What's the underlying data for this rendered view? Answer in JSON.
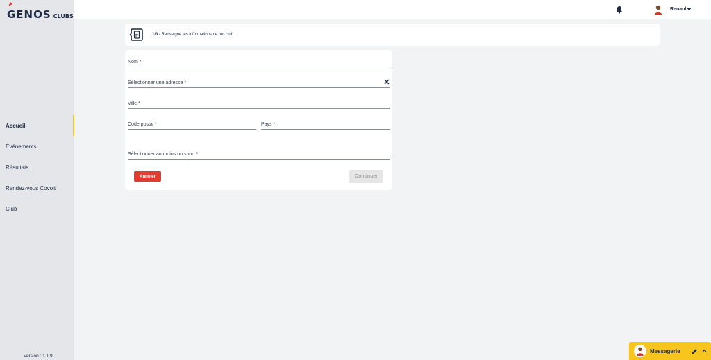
{
  "app": {
    "logo_main": "GENOS",
    "logo_sub": "CLUBS",
    "version": "Version : 1.1.9",
    "accent_color": "#f7c51e"
  },
  "sidebar": {
    "items": [
      {
        "label": "Accueil",
        "active": true
      },
      {
        "label": "Événements",
        "active": false
      },
      {
        "label": "Résultats",
        "active": false
      },
      {
        "label": "Rendez-vous Covoit'",
        "active": false
      },
      {
        "label": "Club",
        "active": false
      }
    ]
  },
  "header": {
    "user_name": "Renault",
    "icons": [
      "bell-icon",
      "avatar",
      "caret-down-icon"
    ]
  },
  "step": {
    "number": "1/3 -",
    "text": " Renseigne les informations de ton club !",
    "icon": "document-icon"
  },
  "form": {
    "nom_label": "Nom *",
    "adresse_label": "Sélectionner une adresse *",
    "ville_label": "Ville *",
    "code_postal_label": "Code postal *",
    "pays_label": "Pays *",
    "sport_label": "Sélectionner au moins un sport *",
    "cancel_label": "Annuler",
    "continue_label": "Continuer",
    "cancel_color": "#e23b30"
  },
  "messaging": {
    "label": "Messagerie"
  }
}
